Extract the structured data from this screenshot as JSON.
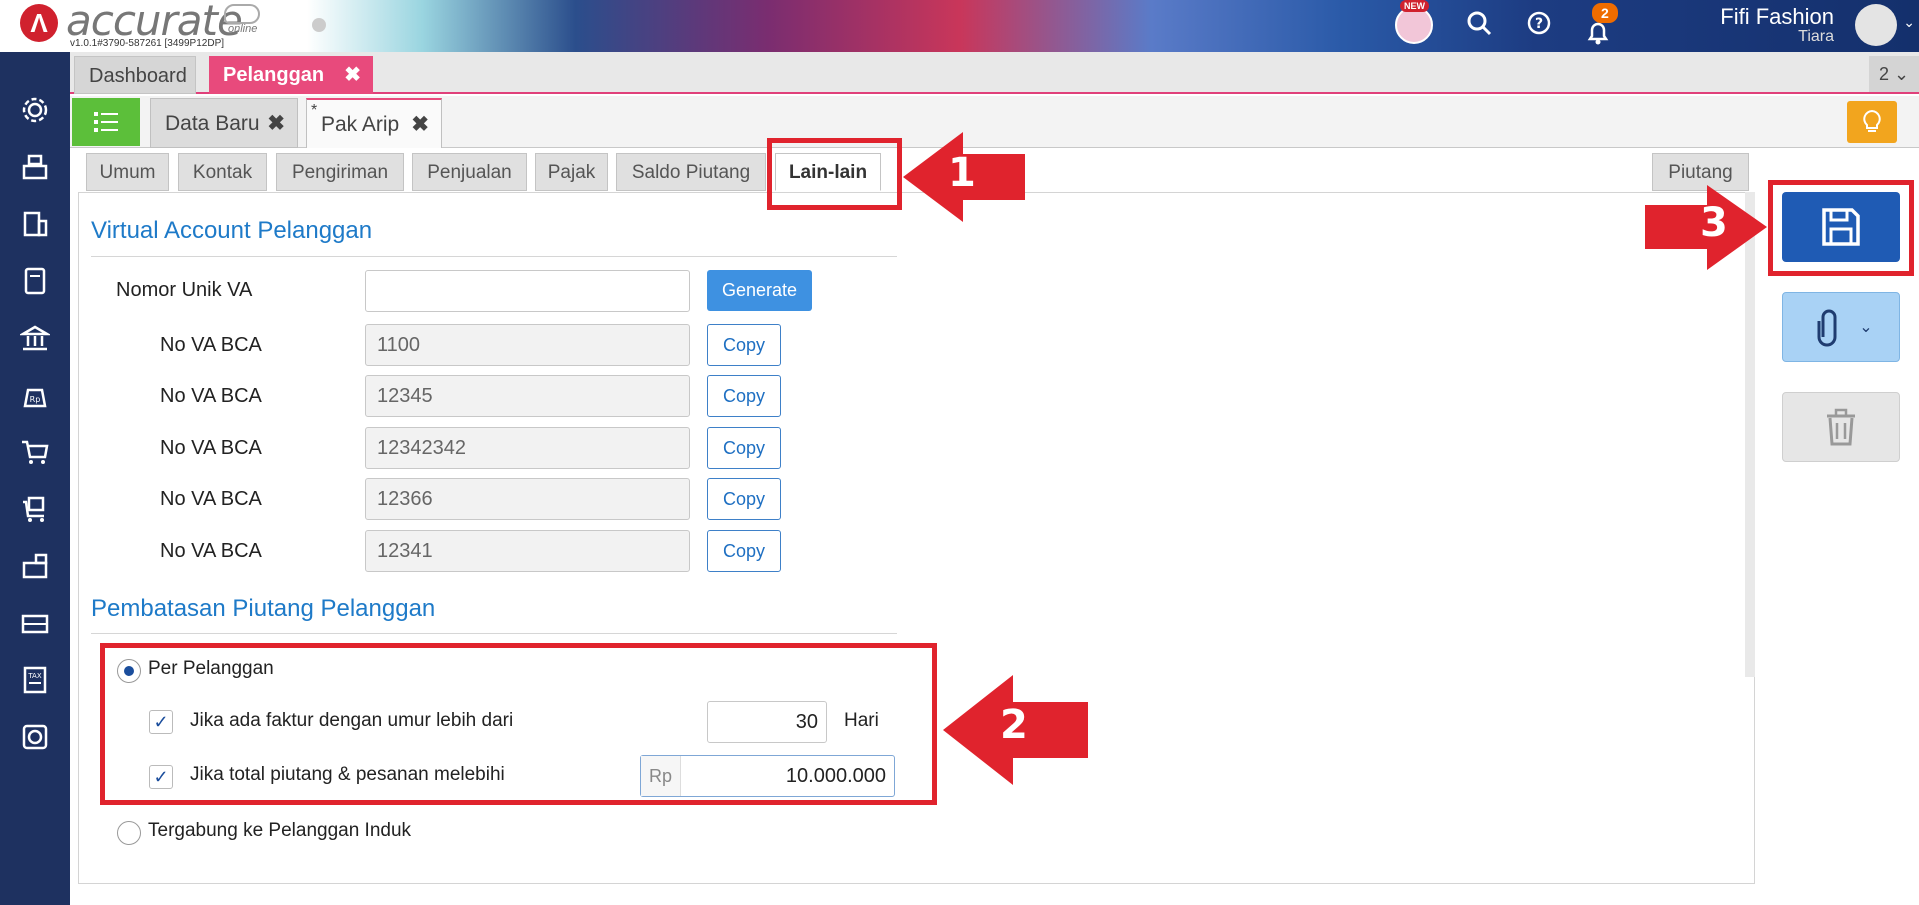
{
  "header": {
    "logo_text": "accurate",
    "logo_sub": "online",
    "version": "v1.0.1#3790-587261 [3499P12DP]",
    "new_badge": "NEW",
    "notif_count": "2",
    "company": "Fifi Fashion",
    "user": "Tiara"
  },
  "modules": {
    "dashboard": "Dashboard",
    "active": "Pelanggan",
    "window_count": "2"
  },
  "doc_tabs": {
    "tab1": "Data Baru",
    "tab2": "Pak Arip",
    "modified_marker": "*"
  },
  "sub_tabs": [
    "Umum",
    "Kontak",
    "Pengiriman",
    "Penjualan",
    "Pajak",
    "Saldo Piutang",
    "Lain-lain"
  ],
  "side_tab": "Piutang",
  "virtual_account": {
    "title": "Virtual Account Pelanggan",
    "unique_label": "Nomor Unik VA",
    "unique_value": "",
    "generate": "Generate",
    "copy_label": "Copy",
    "rows": [
      {
        "label": "No VA BCA",
        "value": "1100"
      },
      {
        "label": "No VA BCA",
        "value": "12345"
      },
      {
        "label": "No VA BCA",
        "value": "12342342"
      },
      {
        "label": "No VA BCA",
        "value": "12366"
      },
      {
        "label": "No VA BCA",
        "value": "12341"
      }
    ]
  },
  "limit": {
    "title": "Pembatasan Piutang Pelanggan",
    "per_pelanggan": "Per Pelanggan",
    "age_label": "Jika ada faktur dengan umur lebih dari",
    "age_value": "30",
    "age_unit": "Hari",
    "total_label": "Jika total piutang & pesanan melebihi",
    "currency": "Rp",
    "total_value": "10.000.000",
    "parent_option": "Tergabung ke Pelanggan Induk"
  },
  "annotations": {
    "n1": "1",
    "n2": "2",
    "n3": "3"
  },
  "colors": {
    "accent_pink": "#e84a7c",
    "annotation_red": "#e0232d",
    "primary_blue": "#1f5bb4",
    "link_blue": "#1e7ac8"
  }
}
